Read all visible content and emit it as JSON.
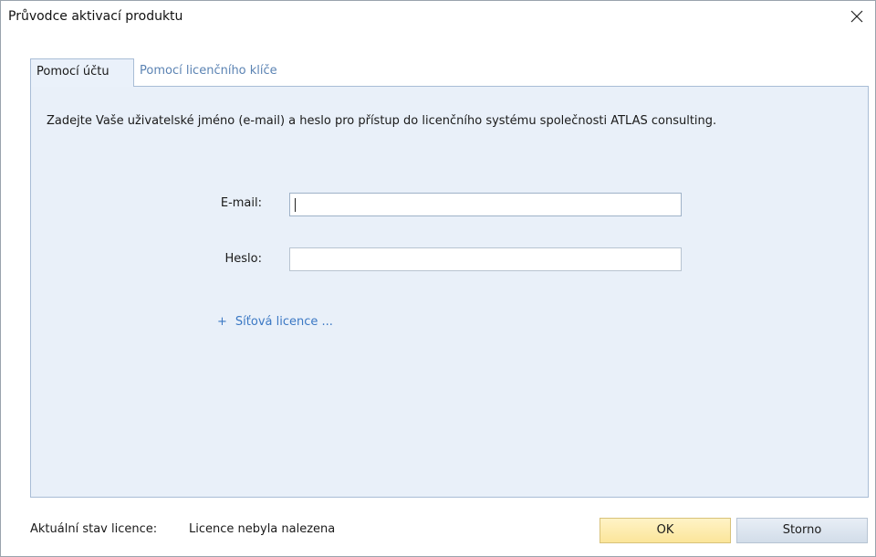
{
  "window": {
    "title": "Průvodce aktivací produktu"
  },
  "tabs": [
    {
      "label": "Pomocí účtu",
      "active": true
    },
    {
      "label": "Pomocí licenčního klíče",
      "active": false
    }
  ],
  "panel": {
    "description": "Zadejte Vaše uživatelské jméno (e-mail) a heslo pro přístup do licenčního systému společnosti ATLAS consulting.",
    "email": {
      "label": "E-mail:",
      "value": "",
      "placeholder": ""
    },
    "password": {
      "label": "Heslo:",
      "value": "",
      "placeholder": ""
    },
    "network_license": {
      "prefix": "+",
      "label": "Síťová licence ..."
    }
  },
  "footer": {
    "status_label": "Aktuální stav licence:",
    "status_value": "Licence nebyla nalezena",
    "ok_label": "OK",
    "cancel_label": "Storno"
  },
  "colors": {
    "panel_bg": "#e9f0f9",
    "link": "#3b78c4",
    "ok_button": "#fbe59a",
    "cancel_button": "#d2dde9"
  },
  "icons": {
    "close": "close-icon"
  }
}
